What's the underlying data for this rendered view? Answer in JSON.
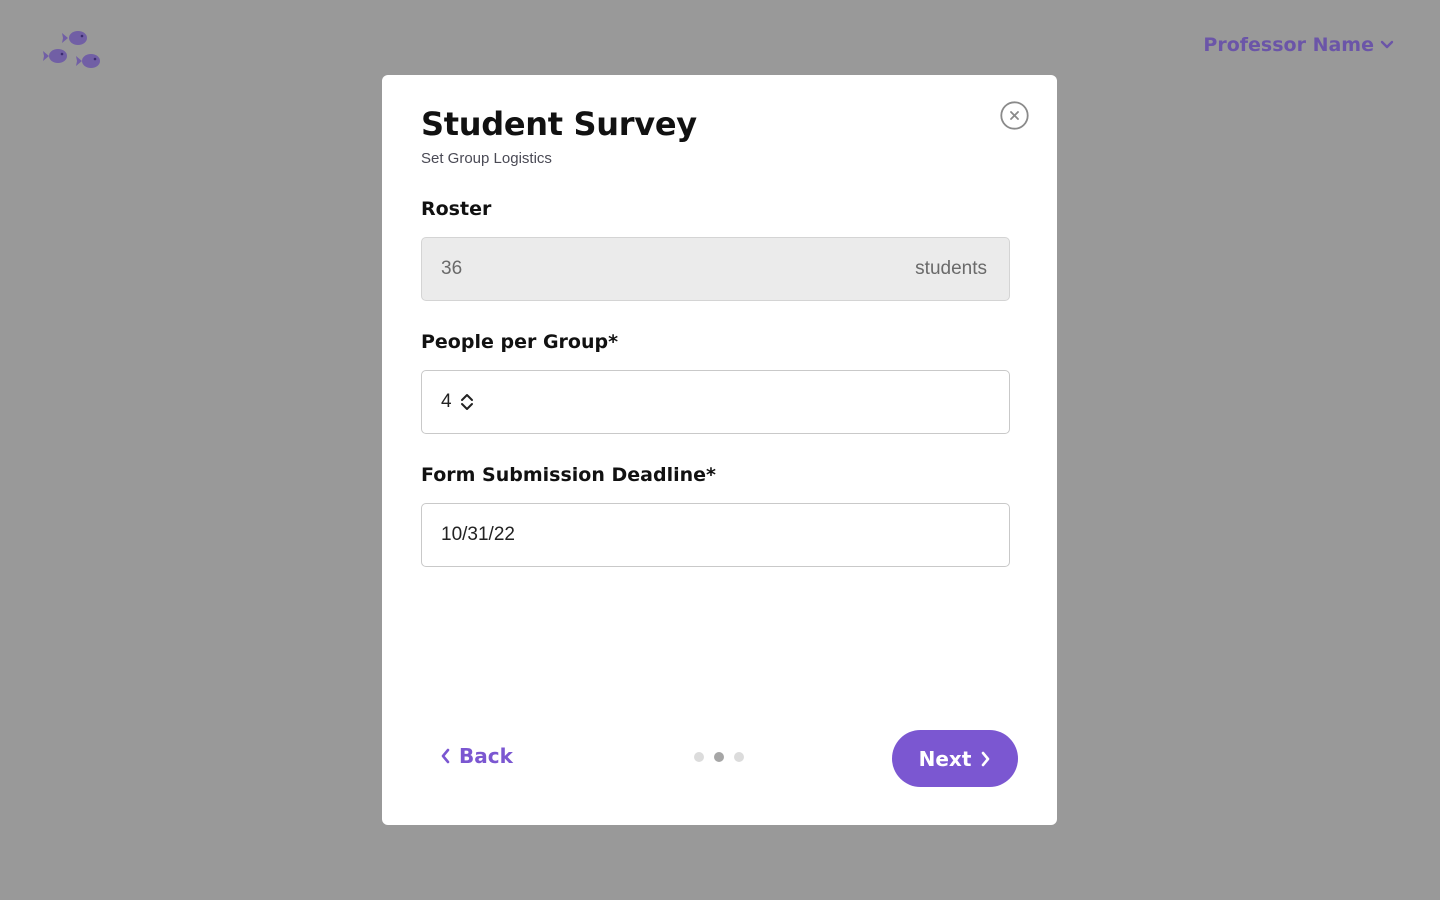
{
  "header": {
    "logo_icon": "fish-school-logo",
    "user_menu_label": "Professor Name",
    "user_menu_icon": "chevron-down-icon"
  },
  "colors": {
    "accent": "#7b57d1",
    "user_menu": "#6b55a8",
    "backdrop": "#999999"
  },
  "modal": {
    "title": "Student Survey",
    "subtitle": "Set Group Logistics",
    "close_icon": "close-circle-icon",
    "fields": {
      "roster": {
        "label": "Roster",
        "value": "36",
        "suffix": "students"
      },
      "group_size": {
        "label": "People per Group*",
        "value": "4"
      },
      "deadline": {
        "label": "Form Submission Deadline*",
        "value": "10/31/22"
      }
    },
    "footer": {
      "back_label": "Back",
      "next_label": "Next",
      "pager": {
        "total": 3,
        "current": 2
      }
    }
  }
}
